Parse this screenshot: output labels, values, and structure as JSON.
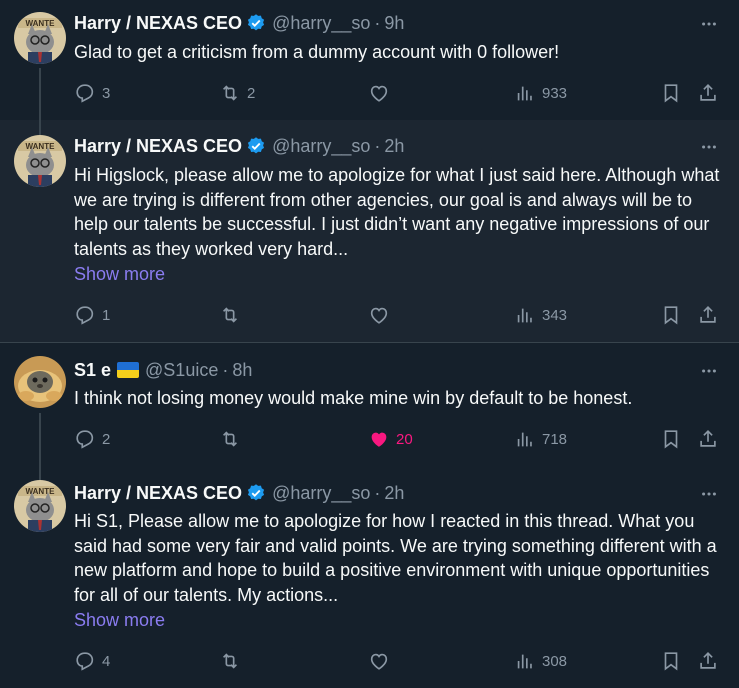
{
  "tweets": [
    {
      "name": "Harry / NEXAS CEO",
      "handle": "@harry__so",
      "time": "9h",
      "text": "Glad to get a criticism from a dummy account with 0 follower!",
      "show_more": "",
      "replies": "3",
      "retweets": "2",
      "likes": "",
      "views": "933"
    },
    {
      "name": "Harry / NEXAS CEO",
      "handle": "@harry__so",
      "time": "2h",
      "text": "Hi Higslock, please allow me to apologize for what I just said here. Although what we are trying is different from other agencies, our goal is and always will be to help our talents be successful. I just didn’t want any negative impressions of our talents as they worked very hard...",
      "show_more": "Show more",
      "replies": "1",
      "retweets": "",
      "likes": "",
      "views": "343"
    },
    {
      "name": "S1 e",
      "handle": "@S1uice",
      "time": "8h",
      "text": "I think not losing money would make mine win by default to be honest.",
      "show_more": "",
      "replies": "2",
      "retweets": "",
      "likes": "20",
      "views": "718"
    },
    {
      "name": "Harry / NEXAS CEO",
      "handle": "@harry__so",
      "time": "2h",
      "text": "Hi S1, Please allow me to apologize for how I reacted in this thread. What you said had some very fair and valid points. We are trying something different with a new platform and hope to build a positive environment with unique opportunities for all of our talents. My actions...",
      "show_more": "Show more",
      "replies": "4",
      "retweets": "",
      "likes": "",
      "views": "308"
    }
  ],
  "avatar_badge_text": "WANTE",
  "colors": {
    "background": "#15202b",
    "text": "#f7f9f9",
    "muted": "#8b98a5",
    "verified": "#1d9bf0",
    "like": "#f91880",
    "link": "#8a7cf0"
  },
  "icons": [
    "reply-icon",
    "retweet-icon",
    "like-icon",
    "views-icon",
    "bookmark-icon",
    "share-icon",
    "more-icon",
    "verified-icon"
  ]
}
